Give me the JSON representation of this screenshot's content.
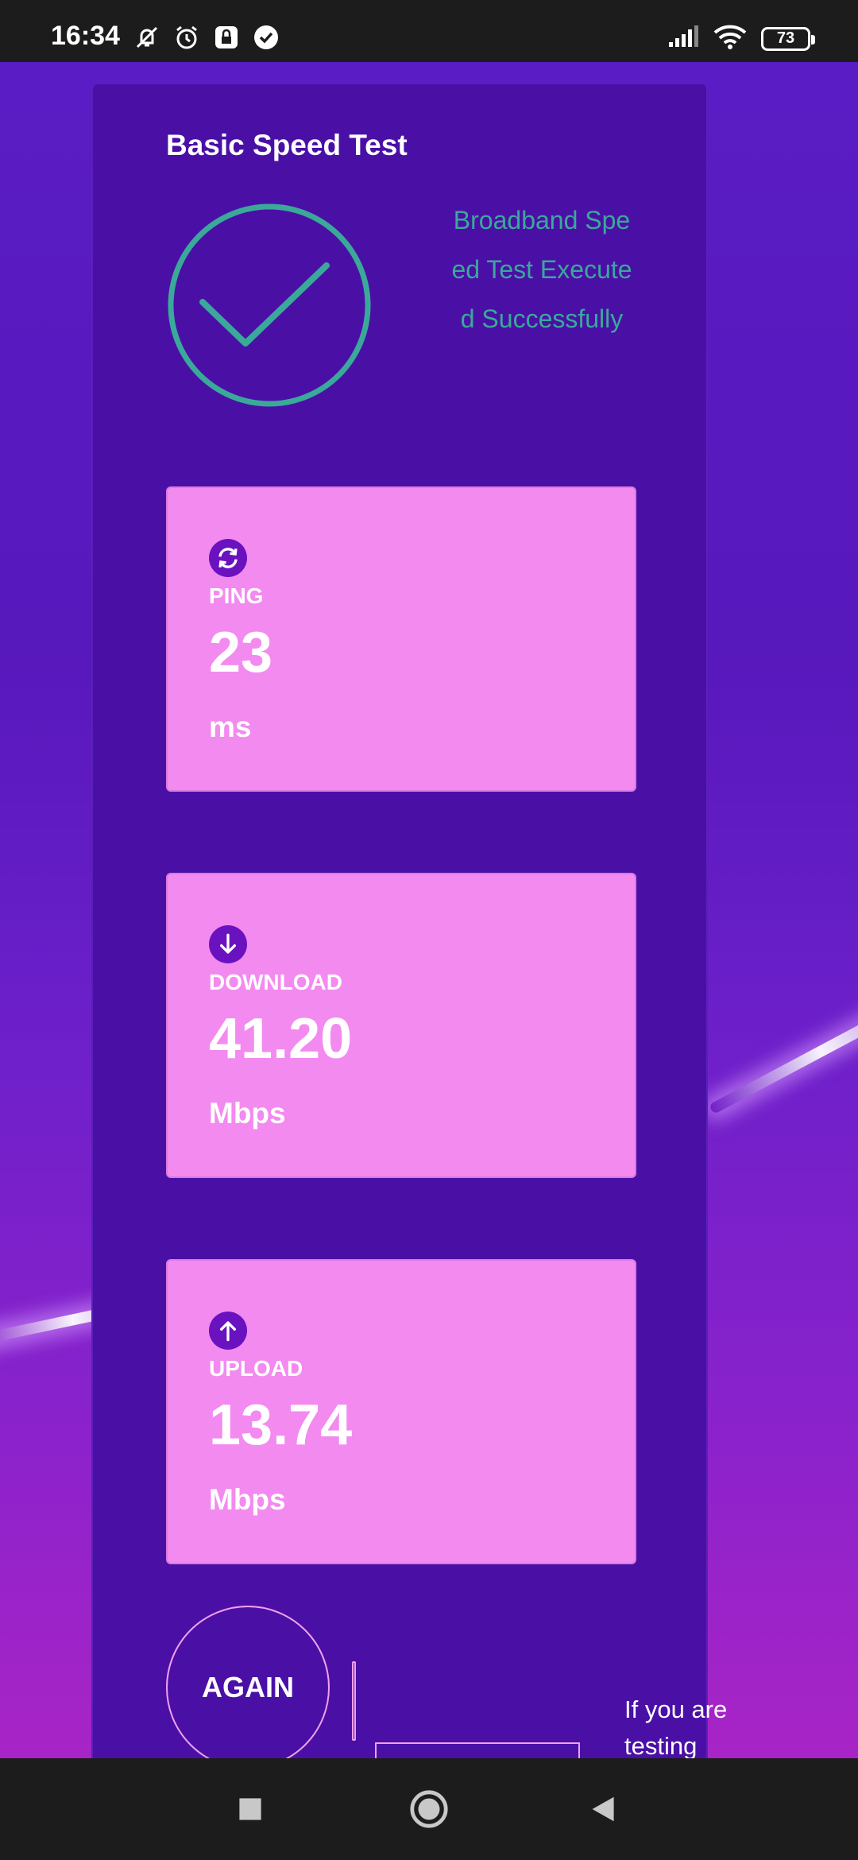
{
  "status_bar": {
    "time": "16:34",
    "battery": "73",
    "icons": [
      "mute-icon",
      "alarm-icon",
      "lock-screen-icon",
      "check-badge-icon",
      "signal-icon",
      "wifi-icon",
      "battery-icon"
    ]
  },
  "panel": {
    "title": "Basic Speed Test",
    "status_message": "Broadband Speed Test Executed Successfully",
    "status_color": "#3aa99a"
  },
  "metrics": [
    {
      "label": "PING",
      "value": "23",
      "unit": "ms",
      "icon": "refresh-icon"
    },
    {
      "label": "DOWNLOAD",
      "value": "41.20",
      "unit": "Mbps",
      "icon": "arrow-down-icon"
    },
    {
      "label": "UPLOAD",
      "value": "13.74",
      "unit": "Mbps",
      "icon": "arrow-up-icon"
    }
  ],
  "actions": {
    "again_label": "AGAIN",
    "hint": "If you are testing"
  },
  "colors": {
    "panel_bg": "#4a10a6",
    "card_bg": "#f38af0",
    "accent_purple": "#6a12c0"
  }
}
